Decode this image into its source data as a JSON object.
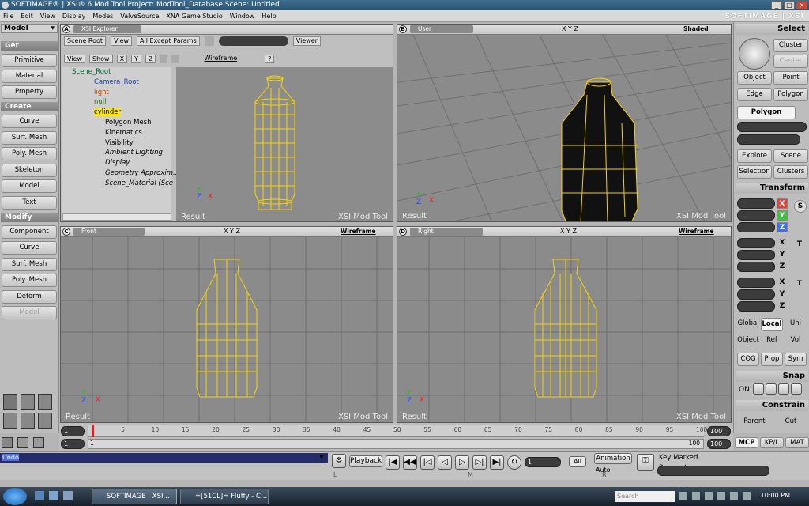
{
  "title": {
    "text": "SOFTIMAGE® | XSI® 6 Mod Tool Project: ModTool_Database    Scene: Untitled",
    "brand": "SOFTIMAGE | XSI"
  },
  "window_controls": {
    "min": "_",
    "max": "□",
    "close": "×"
  },
  "menu": [
    "File",
    "Edit",
    "View",
    "Display",
    "Modes",
    "ValveSource",
    "XNA Game Studio",
    "Window",
    "Help"
  ],
  "left": {
    "module": "Model",
    "sections": {
      "get": "Get",
      "create": "Create",
      "modify": "Modify"
    },
    "get_buttons": [
      "Primitive",
      "Material",
      "Property"
    ],
    "create_buttons": [
      "Curve",
      "Surf. Mesh",
      "Poly. Mesh",
      "Skeleton",
      "Model",
      "Text"
    ],
    "modify_buttons": [
      "Component",
      "Curve",
      "Surf. Mesh",
      "Poly. Mesh",
      "Deform",
      "Model"
    ]
  },
  "explorer": {
    "label": "A",
    "title": "XSI Explorer",
    "toolbar1": [
      "Scene Root",
      "View",
      "All Except Params",
      "Viewer"
    ],
    "toolbar2": [
      "View",
      "Show",
      "X",
      "Y",
      "Z"
    ],
    "wireframe": "Wireframe",
    "help": "?",
    "tree": [
      "Scene_Root",
      "Camera_Root",
      "light",
      "null",
      "cylinder",
      "Polygon Mesh",
      "Kinematics",
      "Visibility",
      "Ambient Lighting",
      "Display",
      "Geometry Approxim...",
      "Scene_Material (Sce"
    ]
  },
  "viewports": {
    "a": {
      "result": "Result",
      "tool": "XSI Mod Tool"
    },
    "b": {
      "label": "B",
      "camera": "User",
      "mode": "Shaded",
      "xyz": "X Y Z",
      "result": "Result",
      "tool": "XSI Mod Tool"
    },
    "c": {
      "label": "C",
      "camera": "Front",
      "mode": "Wireframe",
      "xyz": "X Y Z",
      "result": "Result",
      "tool": "XSI Mod Tool"
    },
    "d": {
      "label": "D",
      "camera": "Right",
      "mode": "Wireframe",
      "xyz": "X Y Z",
      "result": "Result",
      "tool": "XSI Mod Tool"
    }
  },
  "right": {
    "select": "Select",
    "cluster": "Cluster",
    "center": "Center",
    "object": "Object",
    "point": "Point",
    "edge": "Edge",
    "polygon": "Polygon",
    "polygon_active": "Polygon",
    "explore": "Explore",
    "scene": "Scene",
    "selection": "Selection",
    "clusters": "Clusters",
    "transform": "Transform",
    "x": "X",
    "y": "Y",
    "z": "Z",
    "s": "S",
    "r": "R",
    "t": "T",
    "global": "Global",
    "local": "Local",
    "uni": "Uni",
    "object2": "Object",
    "ref": "Ref",
    "vol": "Vol",
    "cog": "COG",
    "prop": "Prop",
    "sym": "Sym",
    "snap": "Snap",
    "on": "ON",
    "constrain": "Constrain",
    "parent": "Parent",
    "cut": "Cut",
    "tabs": [
      "MCP",
      "KP/L",
      "MAT"
    ]
  },
  "timeline": {
    "start": "1",
    "end": "100",
    "ticks": [
      "5",
      "10",
      "15",
      "20",
      "25",
      "30",
      "35",
      "40",
      "45",
      "50",
      "55",
      "60",
      "65",
      "70",
      "75",
      "80",
      "85",
      "90",
      "95",
      "100"
    ],
    "current": "1",
    "start2": "1",
    "end2": "100"
  },
  "bottom": {
    "command": "Undo",
    "playback": "Playback",
    "frame": "1",
    "all": "All",
    "animation": "Animation",
    "auto": "Auto",
    "key_marked": "Key Marked Parameters",
    "lmr": [
      "L",
      "M",
      "R"
    ]
  },
  "taskbar": {
    "items": [
      "SOFTIMAGE | XSI...",
      "=[51CL]= Fluffy - C..."
    ],
    "time": "10:00 PM",
    "search": "Search"
  }
}
